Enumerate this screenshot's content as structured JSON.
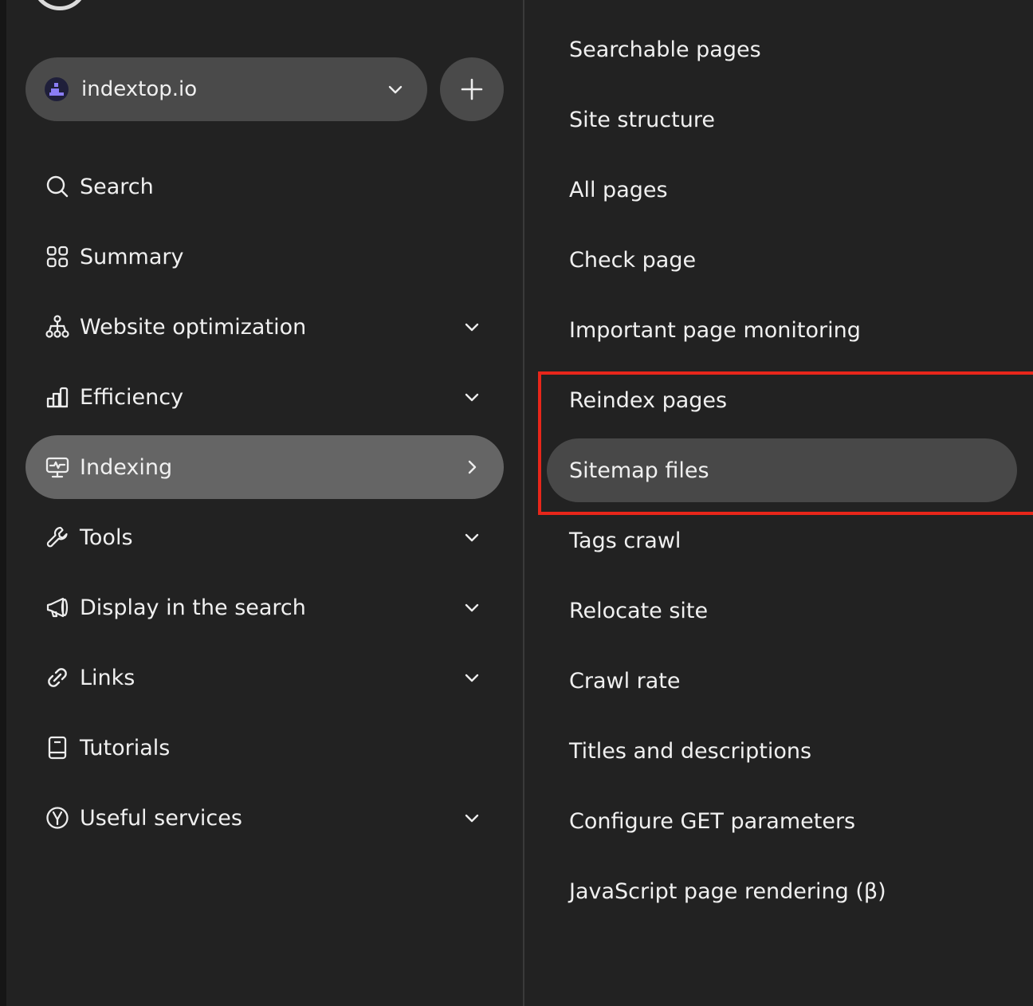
{
  "site_selector": {
    "site_name": "indextop.io",
    "favicon_color": "#8a7df5"
  },
  "sidebar": {
    "items": [
      {
        "label": "Search",
        "icon": "search-icon",
        "expandable": false
      },
      {
        "label": "Summary",
        "icon": "grid-icon",
        "expandable": false
      },
      {
        "label": "Website optimization",
        "icon": "sitemap-icon",
        "expandable": true
      },
      {
        "label": "Efficiency",
        "icon": "bar-chart-icon",
        "expandable": true
      },
      {
        "label": "Indexing",
        "icon": "monitor-pulse-icon",
        "expandable": true,
        "active": true
      },
      {
        "label": "Tools",
        "icon": "wrench-icon",
        "expandable": true
      },
      {
        "label": "Display in the search",
        "icon": "megaphone-icon",
        "expandable": true
      },
      {
        "label": "Links",
        "icon": "link-icon",
        "expandable": true
      },
      {
        "label": "Tutorials",
        "icon": "book-icon",
        "expandable": false
      },
      {
        "label": "Useful services",
        "icon": "yandex-circle-icon",
        "expandable": true
      }
    ]
  },
  "submenu": {
    "items": [
      {
        "label": "Searchable pages"
      },
      {
        "label": "Site structure"
      },
      {
        "label": "All pages"
      },
      {
        "label": "Check page"
      },
      {
        "label": "Important page monitoring"
      },
      {
        "label": "Reindex pages"
      },
      {
        "label": "Sitemap files",
        "active": true
      },
      {
        "label": "Tags crawl"
      },
      {
        "label": "Relocate site"
      },
      {
        "label": "Crawl rate"
      },
      {
        "label": "Titles and descriptions"
      },
      {
        "label": "Configure GET parameters"
      },
      {
        "label": "JavaScript page rendering (β)"
      }
    ]
  },
  "colors": {
    "background": "#222222",
    "active_item": "#656565",
    "active_subitem": "#484848",
    "highlight_border": "#e8261a"
  }
}
